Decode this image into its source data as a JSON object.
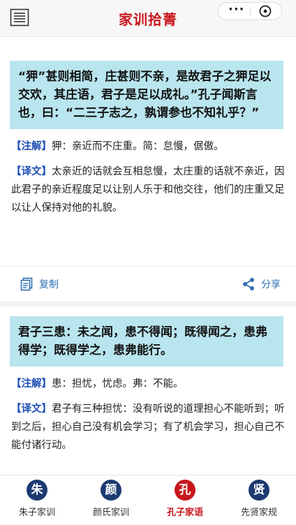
{
  "header": {
    "title": "家训拾菁",
    "more_label": "···"
  },
  "cards": [
    {
      "quote": "“狎”甚则相简，庄甚则不亲，是故君子之狎足以交欢，其庄语，君子是足以成礼。”孔子闻斯言也，曰：“二三子志之，孰谓参也不知礼乎？”",
      "note_tag": "【注解】",
      "note": "狎：亲近而不庄重。简：怠慢，倨傲。",
      "trans_tag": "【译文】",
      "trans": "太亲近的话就会互相怠慢，太庄重的话就不亲近，因此君子的亲近程度足以让别人乐于和他交往，他们的庄重又足以让人保持对他的礼貌。",
      "copy_label": "复制",
      "share_label": "分享"
    },
    {
      "quote": "君子三患：未之闻，患不得闻；既得闻之，患弗得学；既得学之，患弗能行。",
      "note_tag": "【注解】",
      "note": "患：担忧，忧虑。弗：不能。",
      "trans_tag": "【译文】",
      "trans": "君子有三种担忧：没有听说的道理担心不能听到；听到之后，担心自己没有机会学习；有了机会学习，担心自己不能付诸行动。"
    }
  ],
  "tabs": [
    {
      "badge": "朱",
      "label": "朱子家训",
      "active": false
    },
    {
      "badge": "颜",
      "label": "颜氏家训",
      "active": false
    },
    {
      "badge": "孔",
      "label": "孔子家语",
      "active": true
    },
    {
      "badge": "贤",
      "label": "先贤家规",
      "active": false
    }
  ],
  "colors": {
    "accent_red": "#c8161d",
    "navy": "#1c3a70",
    "quote_bg": "#b9e5ee",
    "tag_blue": "#1f4fb3",
    "action_blue": "#2f6fb4"
  }
}
